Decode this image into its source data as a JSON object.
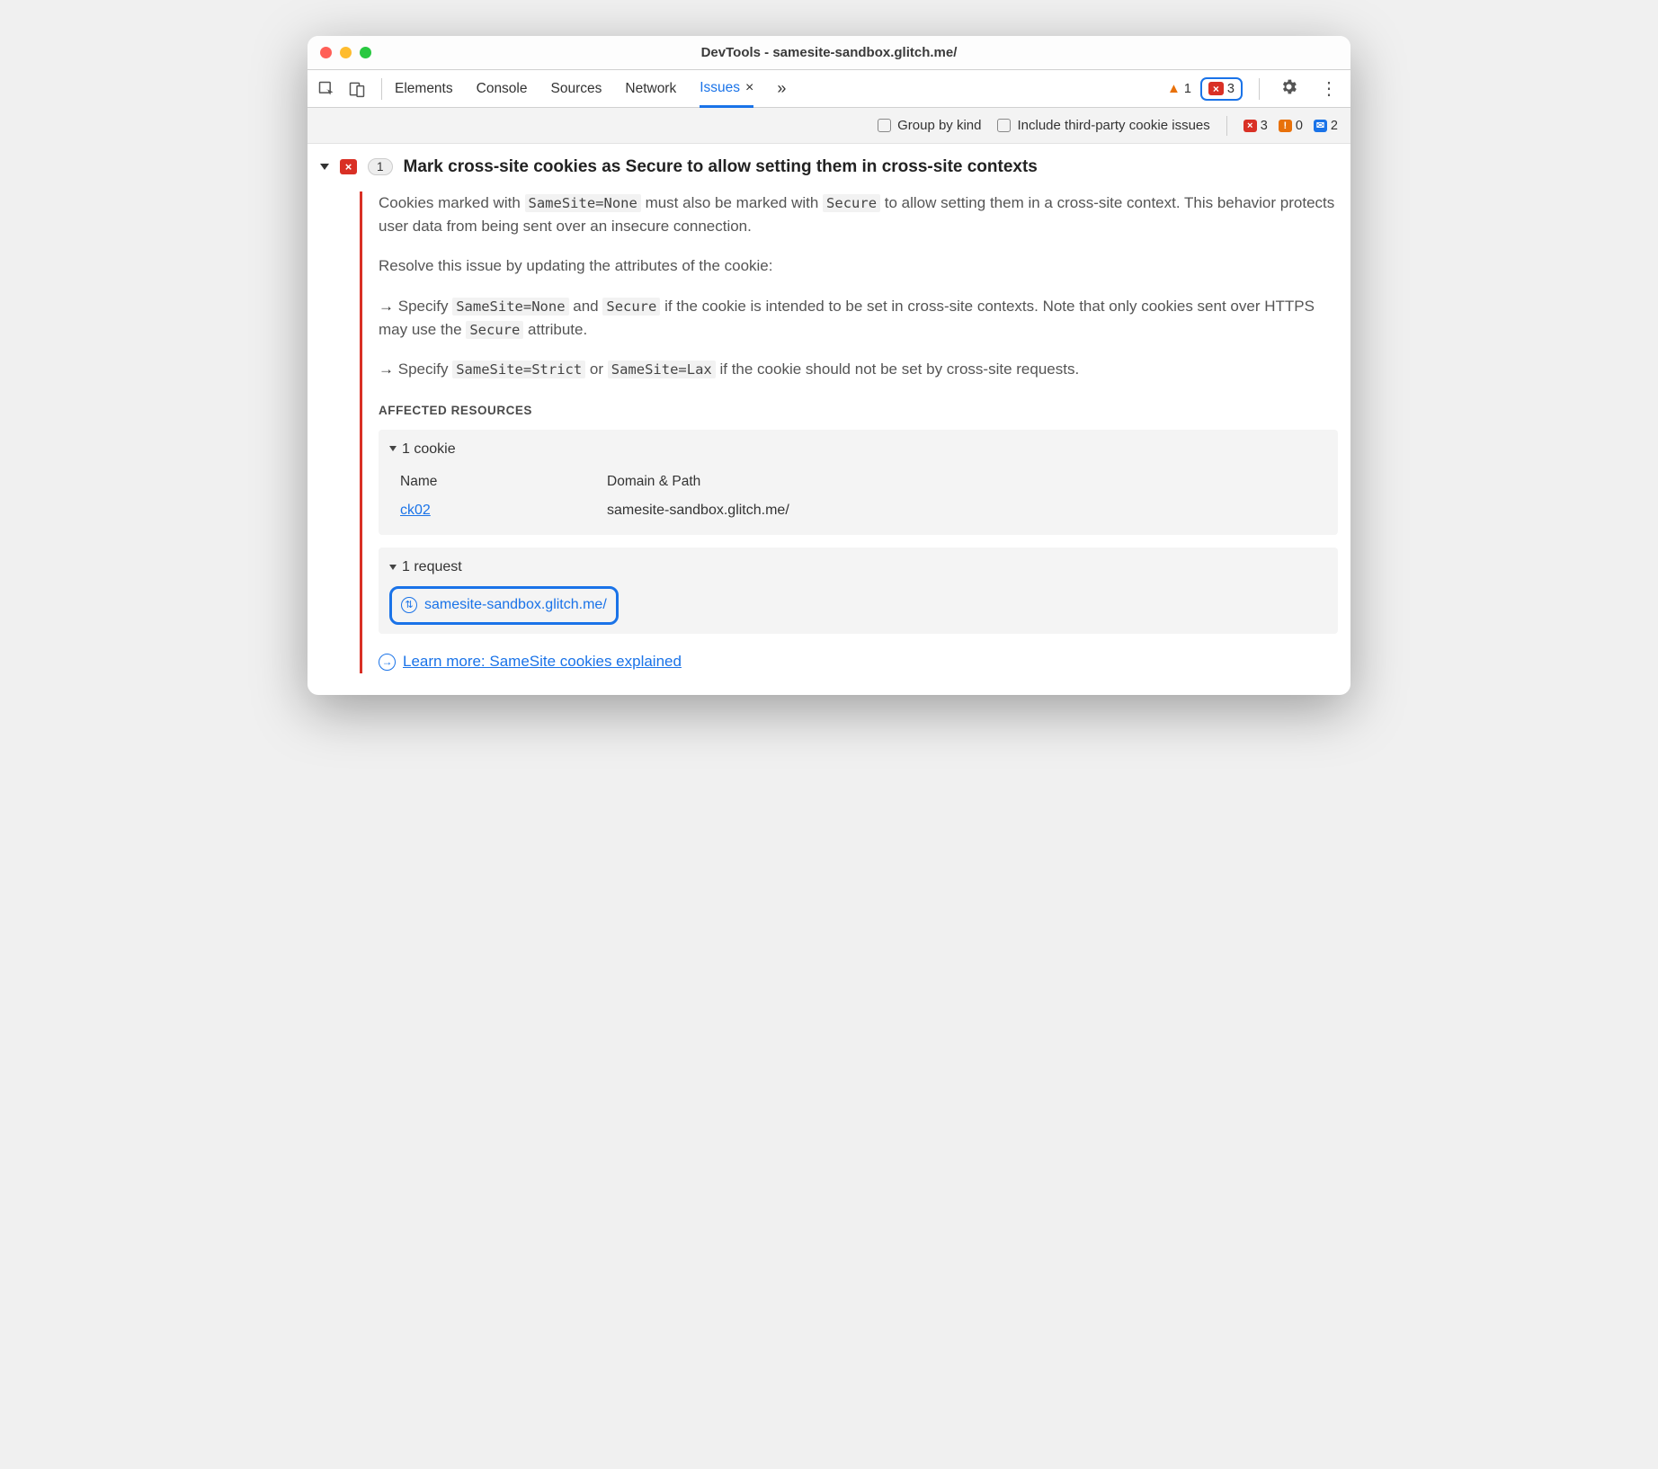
{
  "window": {
    "title": "DevTools - samesite-sandbox.glitch.me/"
  },
  "tabs": {
    "list": [
      "Elements",
      "Console",
      "Sources",
      "Network"
    ],
    "active": "Issues",
    "active_close": "×",
    "more": "»"
  },
  "toolbar_badges": {
    "warn_count": "1",
    "err_count": "3"
  },
  "filters": {
    "group_by_kind": "Group by kind",
    "third_party": "Include third-party cookie issues",
    "counts": {
      "errors": "3",
      "warnings": "0",
      "info": "2"
    }
  },
  "issue": {
    "count": "1",
    "title": "Mark cross-site cookies as Secure to allow setting them in cross-site contexts",
    "p1_a": "Cookies marked with ",
    "p1_code1": "SameSite=None",
    "p1_b": " must also be marked with ",
    "p1_code2": "Secure",
    "p1_c": " to allow setting them in a cross-site context. This behavior protects user data from being sent over an insecure connection.",
    "p2": "Resolve this issue by updating the attributes of the cookie:",
    "b1_a": "Specify ",
    "b1_code1": "SameSite=None",
    "b1_b": " and ",
    "b1_code2": "Secure",
    "b1_c": " if the cookie is intended to be set in cross-site contexts. Note that only cookies sent over HTTPS may use the ",
    "b1_code3": "Secure",
    "b1_d": " attribute.",
    "b2_a": "Specify ",
    "b2_code1": "SameSite=Strict",
    "b2_b": " or ",
    "b2_code2": "SameSite=Lax",
    "b2_c": " if the cookie should not be set by cross-site requests.",
    "affected_heading": "AFFECTED RESOURCES",
    "cookie_section": "1 cookie",
    "col_name": "Name",
    "col_domain": "Domain & Path",
    "cookie_name": "ck02",
    "cookie_domain": "samesite-sandbox.glitch.me/",
    "request_section": "1 request",
    "request_url": "samesite-sandbox.glitch.me/",
    "learn_more": "Learn more: SameSite cookies explained"
  }
}
